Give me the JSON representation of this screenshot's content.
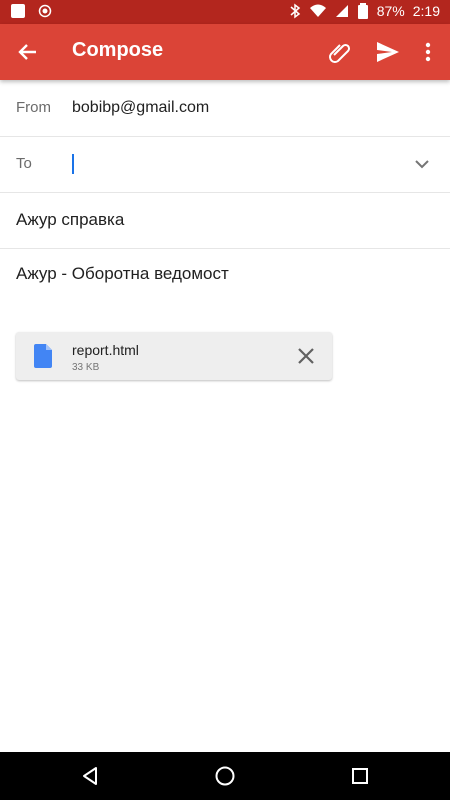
{
  "status_bar": {
    "battery": "87%",
    "time": "2:19",
    "icons": [
      "notification-square-icon",
      "record-icon",
      "bluetooth-icon",
      "wifi-icon",
      "signal-icon",
      "battery-icon"
    ]
  },
  "app_bar": {
    "title": "Compose",
    "color": "#db4437",
    "icons": [
      "back-arrow-icon",
      "attach-icon",
      "send-icon",
      "more-vert-icon"
    ]
  },
  "from": {
    "label": "From",
    "value": "bobibp@gmail.com"
  },
  "to": {
    "label": "To",
    "value": ""
  },
  "subject": "Ажур справка",
  "body": "Ажур - Оборотна ведомост",
  "attachment": {
    "name": "report.html",
    "size": "33 KB",
    "icon_color": "#4285f4"
  },
  "nav_bar": {
    "icons": [
      "back-triangle-icon",
      "home-circle-icon",
      "recents-square-icon"
    ]
  }
}
